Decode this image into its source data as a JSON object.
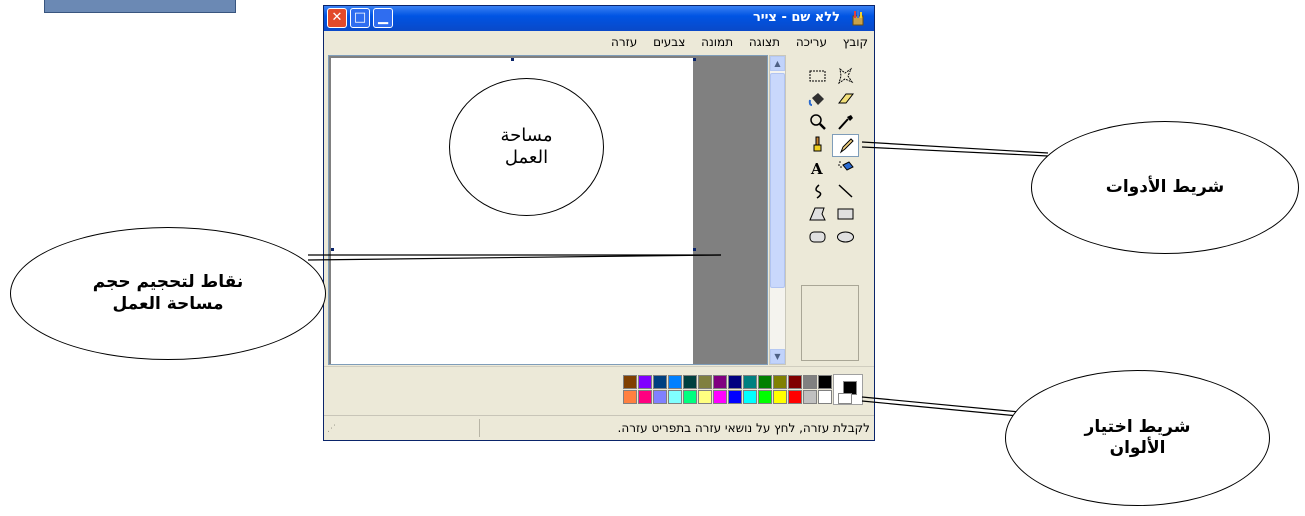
{
  "window": {
    "title": "ללא שם - צייר",
    "menu": [
      "קובץ",
      "עריכה",
      "תצוגה",
      "תמונה",
      "צבעים",
      "עזרה"
    ]
  },
  "status_bar": {
    "text": "לקבלת עזרה, לחץ על נושאי עזרה בתפריט עזרה."
  },
  "tools": [
    {
      "name": "free-form-select-icon"
    },
    {
      "name": "rect-select-icon"
    },
    {
      "name": "eraser-icon"
    },
    {
      "name": "fill-icon"
    },
    {
      "name": "color-picker-icon"
    },
    {
      "name": "magnifier-icon"
    },
    {
      "name": "pencil-icon",
      "selected": true
    },
    {
      "name": "brush-icon"
    },
    {
      "name": "airbrush-icon"
    },
    {
      "name": "text-icon"
    },
    {
      "name": "line-icon"
    },
    {
      "name": "curve-icon"
    },
    {
      "name": "rectangle-icon"
    },
    {
      "name": "polygon-icon"
    },
    {
      "name": "ellipse-icon"
    },
    {
      "name": "rounded-rect-icon"
    }
  ],
  "palette": {
    "row1": [
      "#000000",
      "#808080",
      "#800000",
      "#808000",
      "#008000",
      "#008080",
      "#000080",
      "#800080",
      "#808040",
      "#004040",
      "#0080ff",
      "#004080",
      "#8000ff",
      "#804000"
    ],
    "row2": [
      "#ffffff",
      "#c0c0c0",
      "#ff0000",
      "#ffff00",
      "#00ff00",
      "#00ffff",
      "#0000ff",
      "#ff00ff",
      "#ffff80",
      "#00ff80",
      "#80ffff",
      "#8080ff",
      "#ff0080",
      "#ff8040"
    ],
    "foreground": "#000000",
    "background": "#ffffff"
  },
  "callouts": {
    "work_area": [
      "مساحة",
      "العمل"
    ],
    "tools_bar": "شريط الأدوات",
    "resize_points": [
      "نقاط لتحجيم حجم",
      "مساحة العمل"
    ],
    "colors_bar": [
      "شريط اختيار",
      "الألوان"
    ]
  }
}
